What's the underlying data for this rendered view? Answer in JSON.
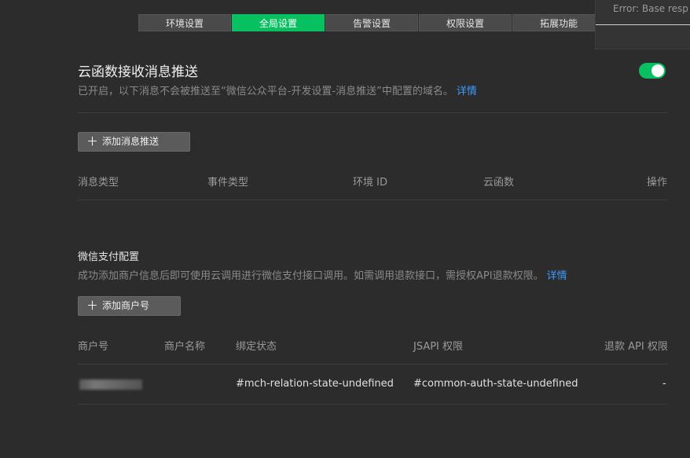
{
  "tabs": [
    {
      "label": "环境设置"
    },
    {
      "label": "全局设置"
    },
    {
      "label": "告警设置"
    },
    {
      "label": "权限设置"
    },
    {
      "label": "拓展功能"
    }
  ],
  "active_tab": "全局设置",
  "error_popup": {
    "text": "Error: Base resp a"
  },
  "push_section": {
    "title": "云函数接收消息推送",
    "description": "已开启，以下消息不会被推送至“微信公众平台-开发设置-消息推送”中配置的域名。",
    "detail_link": "详情",
    "toggle_on": true,
    "add_button": "添加消息推送",
    "columns": [
      "消息类型",
      "事件类型",
      "环境 ID",
      "云函数",
      "操作"
    ]
  },
  "pay_section": {
    "title": "微信支付配置",
    "description": "成功添加商户信息后即可使用云调用进行微信支付接口调用。如需调用退款接口，需授权API退款权限。",
    "detail_link": "详情",
    "add_button": "添加商户号",
    "columns": [
      "商户号",
      "商户名称",
      "绑定状态",
      "JSAPI 权限",
      "退款 API 权限"
    ],
    "rows": [
      {
        "merchant_id": "",
        "merchant_name": "",
        "binding_status": "#mch-relation-state-undefined",
        "jsapi_auth": "#common-auth-state-undefined",
        "refund_api_auth": "-"
      }
    ]
  },
  "colors": {
    "accent": "#07c160",
    "link": "#3c9cff",
    "background": "#2c2c2c"
  }
}
